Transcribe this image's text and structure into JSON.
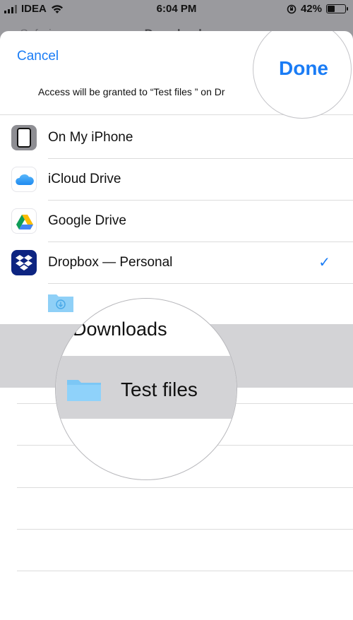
{
  "status_bar": {
    "carrier": "IDEA",
    "time": "6:04 PM",
    "battery": "42%",
    "battery_level": 0.42
  },
  "background_sheet": {
    "back_label": "Safari",
    "title": "Downloads"
  },
  "sheet": {
    "cancel_label": "Cancel",
    "done_label": "Done",
    "access_note": "Access will be granted to “Test files ” on Dr"
  },
  "locations": [
    {
      "label": "On My iPhone",
      "icon": "iphone-icon"
    },
    {
      "label": "iCloud Drive",
      "icon": "cloud-icon"
    },
    {
      "label": "Google Drive",
      "icon": "google-drive-icon"
    },
    {
      "label": "Dropbox — Personal",
      "icon": "dropbox-icon",
      "checked": true
    }
  ],
  "folders": {
    "downloads_label": "Downloads",
    "selected_label": "Test files"
  },
  "colors": {
    "accent": "#1a7cf5",
    "folder": "#7cc7f5",
    "selected_row": "#d3d3d6"
  }
}
